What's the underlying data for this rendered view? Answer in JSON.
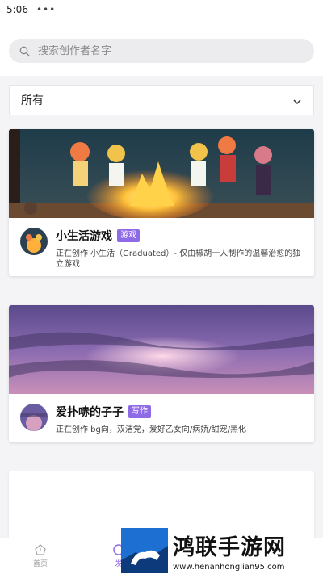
{
  "status": {
    "time": "5:06",
    "dots": "•••"
  },
  "search": {
    "placeholder": "搜索创作者名字"
  },
  "filter": {
    "selected": "所有"
  },
  "creators": [
    {
      "name": "小生活游戏",
      "tag": "游戏",
      "description": "正在创作 小生活（Graduated）- 仅由椒胡一人制作的温馨治愈的独立游戏"
    },
    {
      "name": "爱扑哧的子子",
      "tag": "写作",
      "description": "正在创作 bg向，双洁党，爱好乙女向/病娇/甜宠/黑化"
    }
  ],
  "nav": {
    "home": "首页",
    "discover": "发"
  },
  "watermark": {
    "title": "鸿联手游网",
    "url": "www.henanhonglian95.com"
  },
  "colors": {
    "tag": "#8f6ae6",
    "search_bg": "#ececee",
    "page_bg": "#f4f4f6"
  }
}
